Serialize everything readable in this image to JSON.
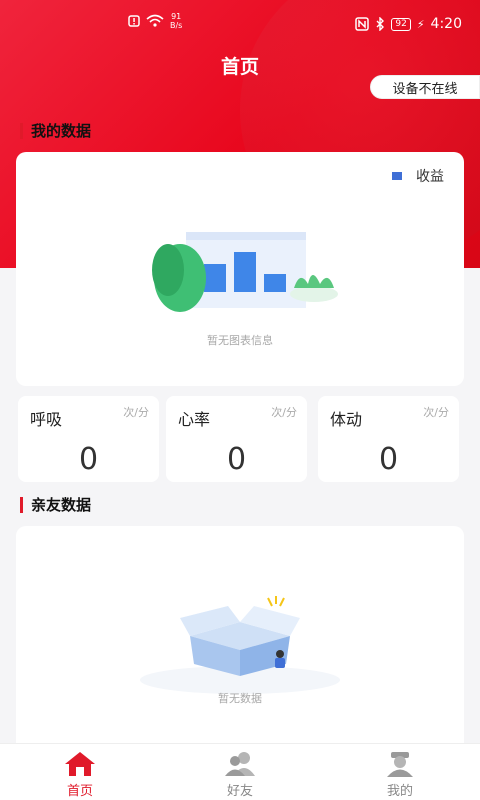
{
  "status_bar": {
    "speed_value": "91",
    "speed_unit": "B/s",
    "battery": "92",
    "time": "4:20"
  },
  "header": {
    "title": "首页",
    "device_status": "设备不在线"
  },
  "my_data": {
    "section_title": "我的数据",
    "legend_label": "收益",
    "empty_text": "暂无图表信息"
  },
  "stats": [
    {
      "name": "呼吸",
      "unit": "次/分",
      "value": "0"
    },
    {
      "name": "心率",
      "unit": "次/分",
      "value": "0"
    },
    {
      "name": "体动",
      "unit": "次/分",
      "value": "0"
    }
  ],
  "friends_data": {
    "section_title": "亲友数据",
    "empty_text": "暂无数据"
  },
  "tabbar": {
    "items": [
      {
        "label": "首页",
        "icon": "home-icon",
        "active": true
      },
      {
        "label": "好友",
        "icon": "friends-icon",
        "active": false
      },
      {
        "label": "我的",
        "icon": "profile-icon",
        "active": false
      }
    ]
  },
  "colors": {
    "primary": "#e8061c",
    "legend": "#3f6fd6"
  }
}
